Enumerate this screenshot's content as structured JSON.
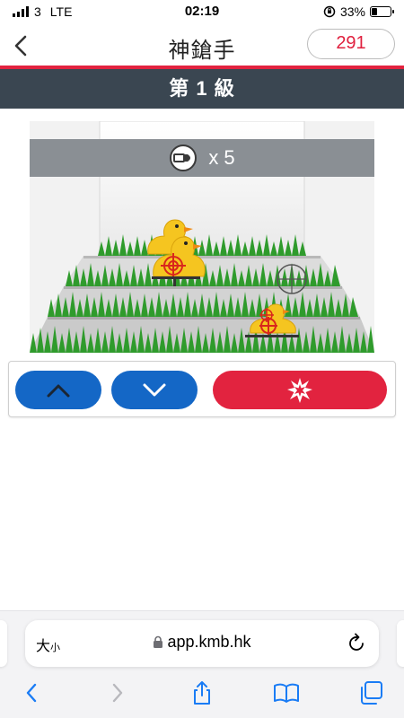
{
  "status_bar": {
    "carrier": "3",
    "network": "LTE",
    "time": "02:19",
    "battery": "33%",
    "battery_level": 0.33
  },
  "header": {
    "title": "神鎗手",
    "score": "291",
    "back_icon": "chevron-left-icon"
  },
  "level": {
    "label": "第 1 級"
  },
  "game": {
    "ammo_icon": "bullet-icon",
    "ammo_count": "x 5"
  },
  "controls": {
    "up_icon": "chevron-up-icon",
    "down_icon": "chevron-down-icon",
    "fire_icon": "explosion-icon"
  },
  "browser": {
    "text_size_label": "大",
    "text_size_small": "小",
    "url": "app.kmb.hk",
    "lock_icon": "lock-icon",
    "reload_icon": "reload-icon",
    "toolbar": [
      "back-icon",
      "forward-icon",
      "share-icon",
      "bookmarks-icon",
      "tabs-icon"
    ]
  },
  "colors": {
    "accent_red": "#e2233f",
    "button_blue": "#1467c6",
    "level_bar": "#3a4651",
    "ios_blue": "#1a7cf5"
  }
}
